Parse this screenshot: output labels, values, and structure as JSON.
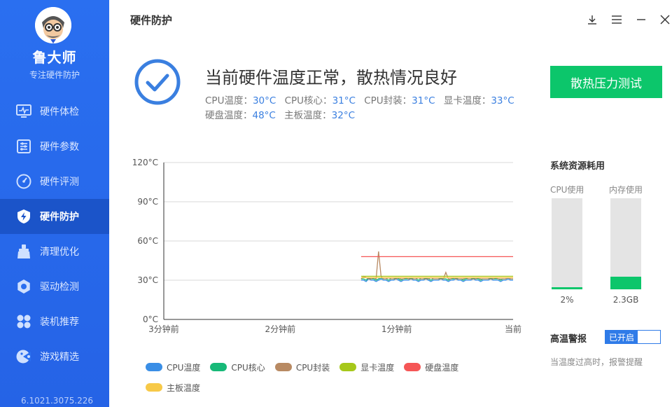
{
  "app": {
    "name": "鲁大师",
    "subtitle": "专注硬件防护",
    "version": "6.1021.3075.226"
  },
  "nav": [
    {
      "label": "硬件体检",
      "icon": "monitor-pulse-icon"
    },
    {
      "label": "硬件参数",
      "icon": "sliders-icon"
    },
    {
      "label": "硬件评测",
      "icon": "gauge-icon"
    },
    {
      "label": "硬件防护",
      "icon": "shield-bolt-icon",
      "active": true
    },
    {
      "label": "清理优化",
      "icon": "broom-icon"
    },
    {
      "label": "驱动检测",
      "icon": "gear-icon"
    },
    {
      "label": "装机推荐",
      "icon": "fan-icon"
    },
    {
      "label": "游戏精选",
      "icon": "game-pad-icon"
    }
  ],
  "header": {
    "title": "硬件防护"
  },
  "status": {
    "title": "当前硬件温度正常，散热情况良好",
    "temps_row1": [
      {
        "label": "CPU温度：",
        "value": "30°C"
      },
      {
        "label": "CPU核心：",
        "value": "31°C"
      },
      {
        "label": "CPU封装：",
        "value": "31°C"
      },
      {
        "label": "显卡温度：",
        "value": "33°C"
      }
    ],
    "temps_row2": [
      {
        "label": "硬盘温度：",
        "value": "48°C"
      },
      {
        "label": "主板温度：",
        "value": "32°C"
      }
    ]
  },
  "stress_button": "散热压力测试",
  "chart_data": {
    "type": "line",
    "y_ticks": [
      "120°C",
      "90°C",
      "60°C",
      "30°C",
      "0°C"
    ],
    "ylim": [
      0,
      120
    ],
    "x_ticks": [
      "3分钟前",
      "2分钟前",
      "1分钟前",
      "当前"
    ],
    "x_start_fraction": 0.565,
    "series": [
      {
        "name": "CPU温度",
        "color": "#3a8ee6",
        "values": [
          30,
          30,
          29,
          31,
          30,
          30,
          29,
          30,
          31,
          30,
          30,
          29,
          30,
          30,
          31,
          30,
          29,
          30,
          30,
          30,
          31,
          30,
          30,
          29,
          30,
          30,
          31,
          30,
          29,
          30,
          30,
          30,
          31,
          30,
          30,
          29,
          30,
          30,
          31,
          30,
          30,
          29,
          30,
          30,
          30,
          31,
          30,
          30,
          29,
          30,
          30,
          30,
          31,
          30,
          30,
          30,
          29,
          30,
          30,
          31,
          30,
          30
        ]
      },
      {
        "name": "CPU核心",
        "color": "#17b978",
        "values": [
          31,
          31,
          30,
          32,
          31,
          31,
          30,
          31,
          32,
          31,
          31,
          30,
          31,
          31,
          32,
          31,
          30,
          31,
          31,
          31,
          32,
          31,
          31,
          30,
          31,
          31,
          32,
          31,
          30,
          31,
          31,
          31,
          32,
          31,
          31,
          30,
          31,
          31,
          32,
          31,
          31,
          30,
          31,
          31,
          31,
          32,
          31,
          31,
          30,
          31,
          31,
          31,
          32,
          31,
          31,
          31,
          30,
          31,
          31,
          32,
          31,
          31
        ]
      },
      {
        "name": "CPU封装",
        "color": "#b88a63",
        "values": [
          31,
          33,
          32,
          31,
          31,
          32,
          31,
          52,
          33,
          31,
          31,
          32,
          31,
          31,
          31,
          32,
          31,
          31,
          32,
          31,
          31,
          31,
          31,
          32,
          31,
          31,
          31,
          31,
          32,
          31,
          31,
          31,
          31,
          31,
          36,
          31,
          31,
          32,
          31,
          31,
          31,
          31,
          32,
          31,
          31,
          31,
          31,
          32,
          31,
          31,
          31,
          31,
          31,
          31,
          32,
          31,
          31,
          31,
          31,
          32,
          31,
          31
        ]
      },
      {
        "name": "显卡温度",
        "color": "#a6c81a",
        "values": [
          33,
          33,
          33,
          33,
          33,
          33,
          33,
          33,
          33,
          33,
          33,
          33,
          33,
          33,
          33,
          33,
          33,
          33,
          33,
          33,
          33,
          33,
          33,
          33,
          33,
          33,
          33,
          33,
          33,
          33,
          33,
          33,
          33,
          33,
          33,
          33,
          33,
          33,
          33,
          33,
          33,
          33,
          33,
          33,
          33,
          33,
          33,
          33,
          33,
          33,
          33,
          33,
          33,
          33,
          33,
          33,
          33,
          33,
          33,
          33,
          33,
          33
        ]
      },
      {
        "name": "硬盘温度",
        "color": "#f55656",
        "values": [
          48,
          48,
          48,
          48,
          48,
          48,
          48,
          48,
          48,
          48,
          48,
          48,
          48,
          48,
          48,
          48,
          48,
          48,
          48,
          48,
          48,
          48,
          48,
          48,
          48,
          48,
          48,
          48,
          48,
          48,
          48,
          48,
          48,
          48,
          48,
          48,
          48,
          48,
          48,
          48,
          48,
          48,
          48,
          48,
          48,
          48,
          48,
          48,
          48,
          48,
          48,
          48,
          48,
          48,
          48,
          48,
          48,
          48,
          48,
          48,
          48,
          48
        ]
      },
      {
        "name": "主板温度",
        "color": "#f7c948",
        "values": [
          32,
          32,
          32,
          32,
          32,
          32,
          32,
          32,
          32,
          32,
          32,
          32,
          32,
          32,
          32,
          32,
          32,
          32,
          32,
          32,
          32,
          32,
          32,
          32,
          32,
          32,
          32,
          32,
          32,
          32,
          32,
          32,
          32,
          32,
          32,
          32,
          32,
          32,
          32,
          32,
          32,
          32,
          32,
          32,
          32,
          32,
          32,
          32,
          32,
          32,
          32,
          32,
          32,
          32,
          32,
          32,
          32,
          32,
          32,
          32,
          32,
          32
        ]
      }
    ]
  },
  "resources": {
    "title": "系统资源耗用",
    "cpu": {
      "label": "CPU使用",
      "value": "2%",
      "fraction": 0.02
    },
    "mem": {
      "label": "内存使用",
      "value": "2.3GB",
      "fraction": 0.14
    }
  },
  "alert": {
    "title": "高温警报",
    "toggle_label": "已开启",
    "description": "当温度过高时，报警提醒"
  },
  "colors": {
    "sidebar": "#2a6ff0",
    "accent_green": "#0cc66b",
    "accent_blue": "#2f7be8"
  }
}
